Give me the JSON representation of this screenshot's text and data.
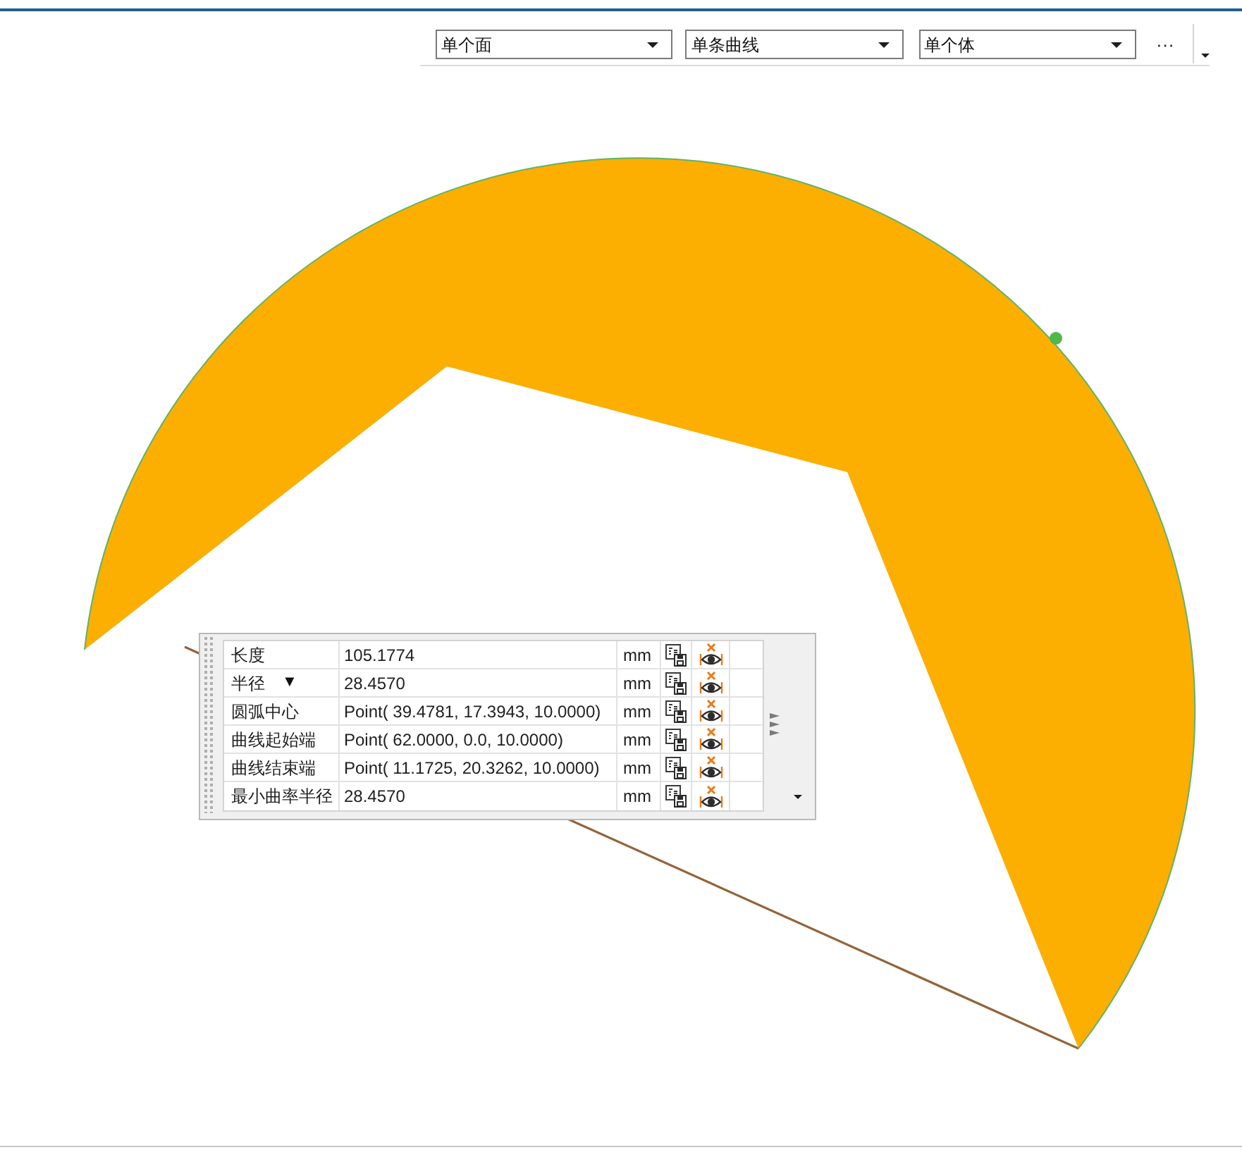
{
  "toolbar": {
    "dropdowns": [
      {
        "value": "单个面"
      },
      {
        "value": "单条曲线"
      },
      {
        "value": "单个体"
      }
    ],
    "more_button": "···"
  },
  "measurement_panel": {
    "rows": [
      {
        "label": "长度",
        "value": "105.1774",
        "unit": "mm"
      },
      {
        "label": "半径",
        "marker": "▼",
        "value": "28.4570",
        "unit": "mm"
      },
      {
        "label": "圆弧中心",
        "value": "Point( 39.4781, 17.3943, 10.0000)",
        "unit": "mm"
      },
      {
        "label": "曲线起始端",
        "value": "Point( 62.0000, 0.0, 10.0000)",
        "unit": "mm"
      },
      {
        "label": "曲线结束端",
        "value": "Point( 11.1725, 20.3262, 10.0000)",
        "unit": "mm"
      },
      {
        "label": "最小曲率半径",
        "value": "28.4570",
        "unit": "mm"
      }
    ]
  }
}
